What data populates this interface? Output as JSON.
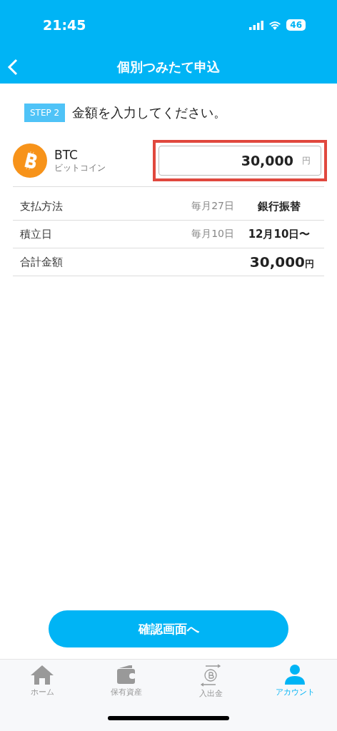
{
  "status_bar": {
    "time": "21:45",
    "battery": "46"
  },
  "header": {
    "title": "個別つみたて申込"
  },
  "step": {
    "badge": "STEP 2",
    "text": "金額を入力してください。"
  },
  "coin": {
    "symbol": "BTC",
    "name": "ビットコイン"
  },
  "amount_field": {
    "value": "30,000",
    "unit": "円",
    "highlighted": true
  },
  "details": [
    {
      "label": "支払方法",
      "middle": "毎月27日",
      "value": "銀行振替"
    },
    {
      "label": "積立日",
      "middle": "毎月10日",
      "value": "12月10日〜"
    },
    {
      "label": "合計金額",
      "value": "30,000",
      "unit": "円"
    }
  ],
  "confirm_button": "確認画面へ",
  "tabs": [
    {
      "label": "ホーム",
      "kind": "home",
      "selected": false
    },
    {
      "label": "保有資産",
      "kind": "wallet",
      "selected": false
    },
    {
      "label": "入出金",
      "kind": "transfer",
      "selected": false
    },
    {
      "label": "アカウント",
      "kind": "account",
      "selected": true
    }
  ]
}
